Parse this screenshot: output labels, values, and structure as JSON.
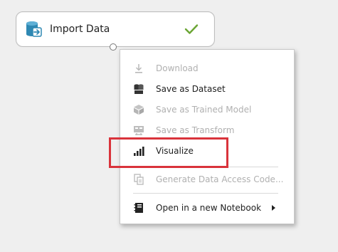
{
  "module": {
    "title": "Import Data",
    "status_icon": "checkmark-icon",
    "type_icon": "database-import-icon",
    "status_color": "#6aa533"
  },
  "context_menu": {
    "items": [
      {
        "label": "Download",
        "icon": "download-icon",
        "enabled": false
      },
      {
        "label": "Save as Dataset",
        "icon": "save-dataset-icon",
        "enabled": true
      },
      {
        "label": "Save as Trained Model",
        "icon": "trained-model-icon",
        "enabled": false
      },
      {
        "label": "Save as Transform",
        "icon": "transform-icon",
        "enabled": false
      },
      {
        "label": "Visualize",
        "icon": "bar-chart-icon",
        "enabled": true
      },
      {
        "label": "Generate Data Access Code...",
        "icon": "code-copy-icon",
        "enabled": false
      },
      {
        "label": "Open in a new Notebook",
        "icon": "notebook-icon",
        "enabled": true,
        "submenu": true
      }
    ],
    "highlight_color": "#d9333b"
  }
}
